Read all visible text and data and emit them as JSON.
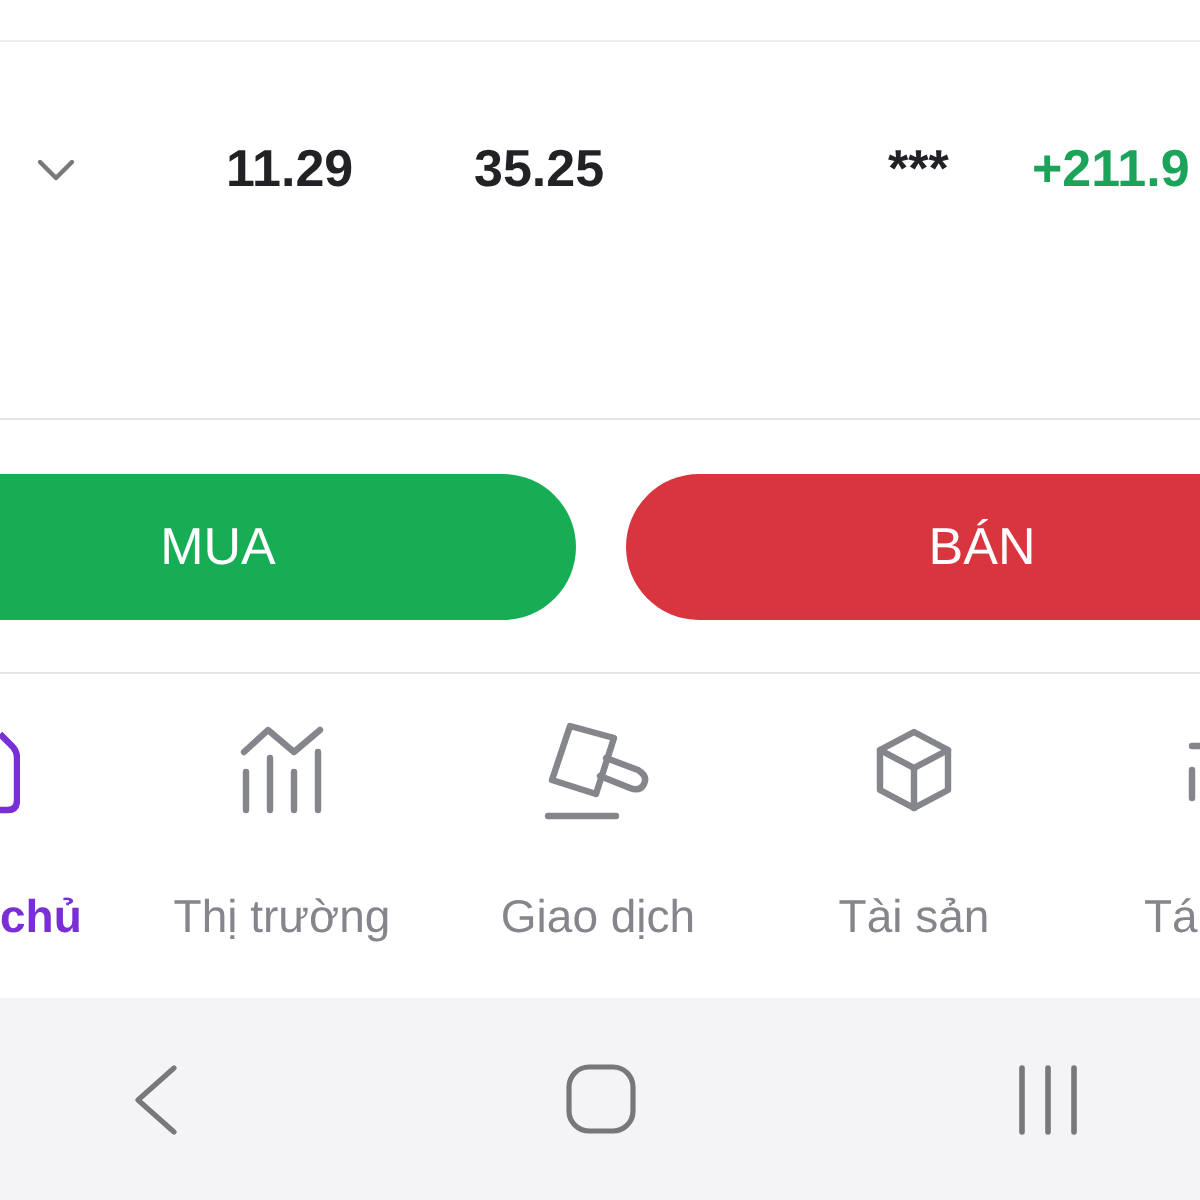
{
  "holding_row": {
    "expanded": false,
    "cells": [
      {
        "text": "11.29",
        "kind": "number"
      },
      {
        "text": "35.25",
        "kind": "number"
      },
      {
        "text": "***",
        "kind": "number"
      },
      {
        "text": "+211.9",
        "kind": "gain"
      }
    ]
  },
  "actions": [
    {
      "label": "MUA",
      "kind": "buy"
    },
    {
      "label": "BÁN",
      "kind": "sell"
    }
  ],
  "bottom_nav": [
    {
      "label": "chủ",
      "selected": true
    },
    {
      "label": "Thị trường",
      "selected": false
    },
    {
      "label": "Giao dịch",
      "selected": false
    },
    {
      "label": "Tài sản",
      "selected": false
    },
    {
      "label": "Tá",
      "selected": false
    }
  ]
}
